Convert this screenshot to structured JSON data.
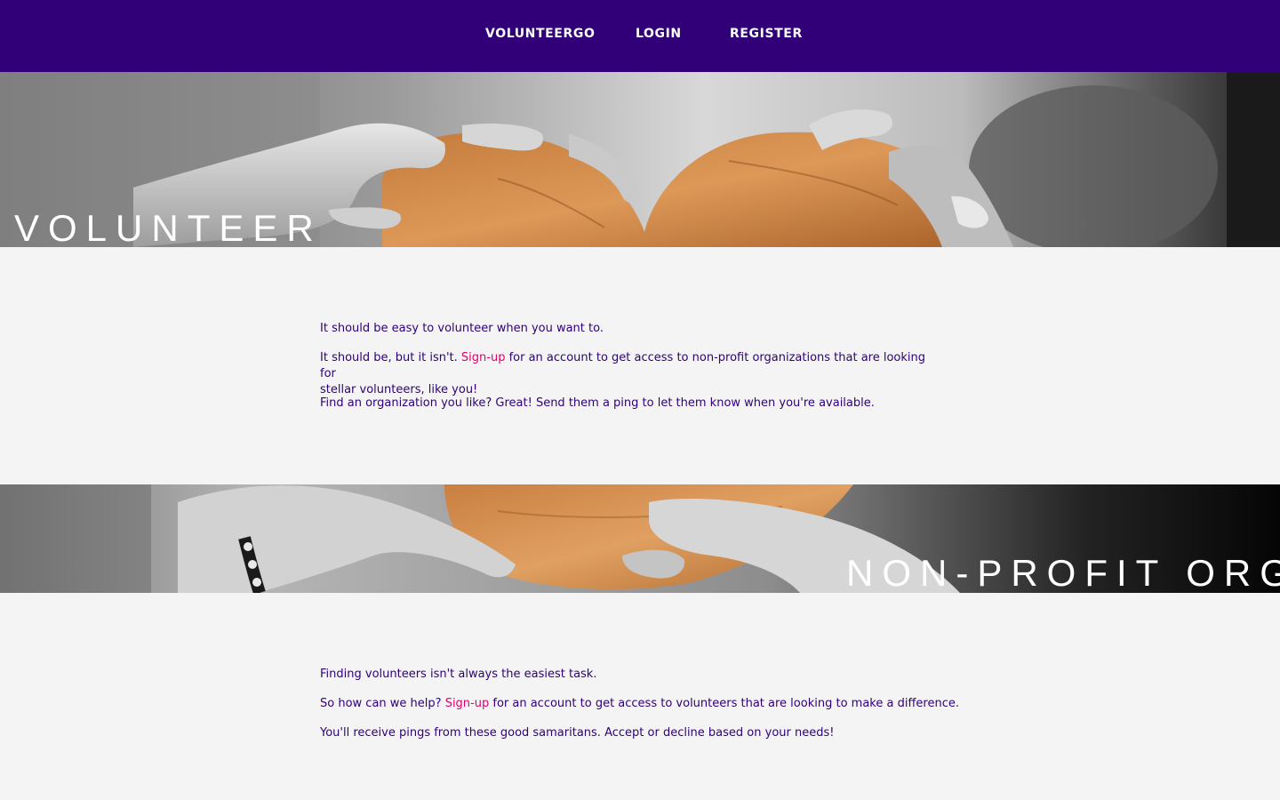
{
  "nav": {
    "brand": "VOLUNTEERGO",
    "login": "LOGIN",
    "register": "REGISTER"
  },
  "volunteer": {
    "title": "VOLUNTEER",
    "p1": "It should be easy to volunteer when you want to.",
    "p2_pre": "It should be, but it isn't. ",
    "p2_link": "Sign-up",
    "p2_post_line1": " for an account to get access to non-profit organizations that are looking for",
    "p2_post_line2": "stellar volunteers, like you!",
    "p3": "Find an organization you like? Great! Send them a ping to let them know when you're available."
  },
  "nonprofit": {
    "title": "NON-PROFIT ORG",
    "p1": "Finding volunteers isn't always the easiest task.",
    "p2_pre": "So how can we help? ",
    "p2_link": "Sign-up",
    "p2_post": " for an account to get access to volunteers that are looking to make a difference.",
    "p3": "You'll receive pings from these good samaritans. Accept or decline based on your needs!"
  },
  "colors": {
    "nav_bg": "#310079",
    "text": "#2f0079",
    "link": "#e0006e",
    "page_bg": "#f4f4f4"
  }
}
